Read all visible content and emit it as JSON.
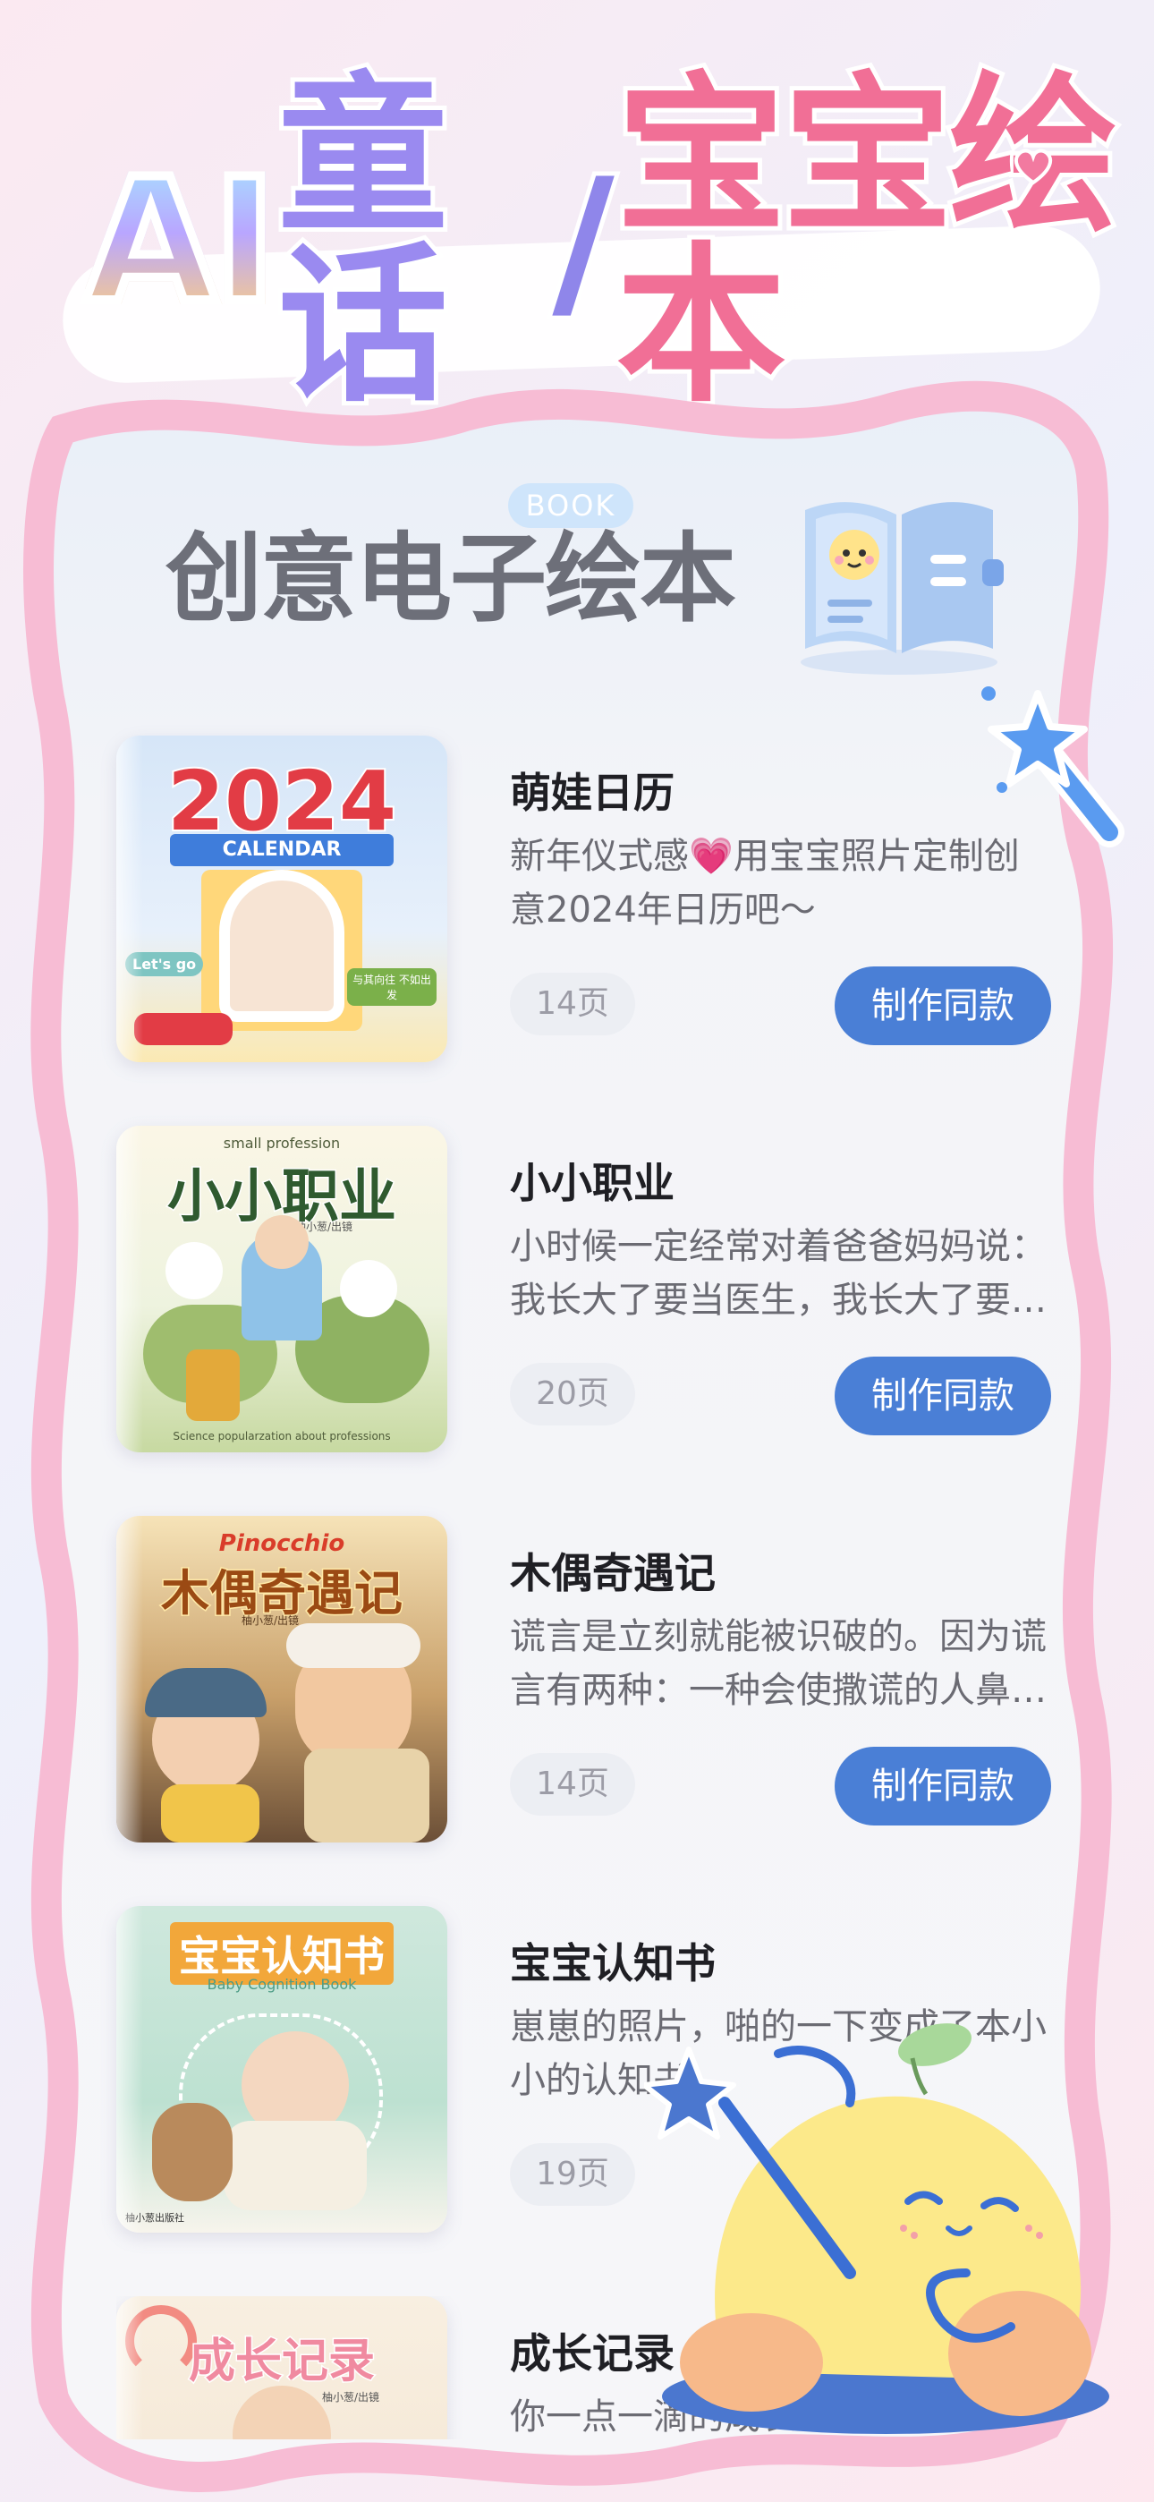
{
  "hero": {
    "ai": "AI",
    "tonghua": "童话",
    "slash": "/",
    "baobao": "宝宝绘本"
  },
  "section": {
    "title": "创意电子绘本",
    "badge": "BOOK"
  },
  "cards": [
    {
      "title": "萌娃日历",
      "desc": "新年仪式感💗用宝宝照片定制创意2024年日历吧～",
      "pages": "14页",
      "button": "制作同款",
      "cover": {
        "top": "2024",
        "sub": "CALENDAR",
        "tag1": "Let's go",
        "tag2": "与其向往 不如出发"
      }
    },
    {
      "title": "小小职业",
      "desc": "小时候一定经常对着爸爸妈妈说：我长大了要当医生，我长大了要当科学家…",
      "pages": "20页",
      "button": "制作同款",
      "cover": {
        "small": "small profession",
        "top": "小小职业",
        "author": "柚小葱/出镜",
        "bottom": "Science popularzation about professions"
      }
    },
    {
      "title": "木偶奇遇记",
      "desc": "谎言是立刻就能被识破的。因为谎言有两种：一种会使撒谎的人鼻子变长…",
      "pages": "14页",
      "button": "制作同款",
      "cover": {
        "small": "Pinocchio",
        "top": "木偶奇遇记",
        "author": "柚小葱/出镜"
      }
    },
    {
      "title": "宝宝认知书",
      "desc": "崽崽的照片，啪的一下变成了本小小的认知书",
      "pages": "19页",
      "button": "制作同款",
      "cover": {
        "top": "宝宝认知书",
        "sub": "Baby Cognition Book",
        "publisher": "柚小葱出版社"
      }
    },
    {
      "title": "成长记录",
      "desc": "你一点一滴的成长",
      "pages": "",
      "button": "",
      "cover": {
        "top": "成长记录",
        "author": "柚小葱/出镜"
      }
    }
  ],
  "colors": {
    "accent": "#4a7fd6",
    "frame": "#f7bcd4",
    "title_pink": "#f16f96",
    "title_purple": "#9a8af0"
  },
  "icons": [
    "heart-icon",
    "open-book-icon",
    "magic-wand-icon",
    "star-icon",
    "mascot-chick"
  ]
}
